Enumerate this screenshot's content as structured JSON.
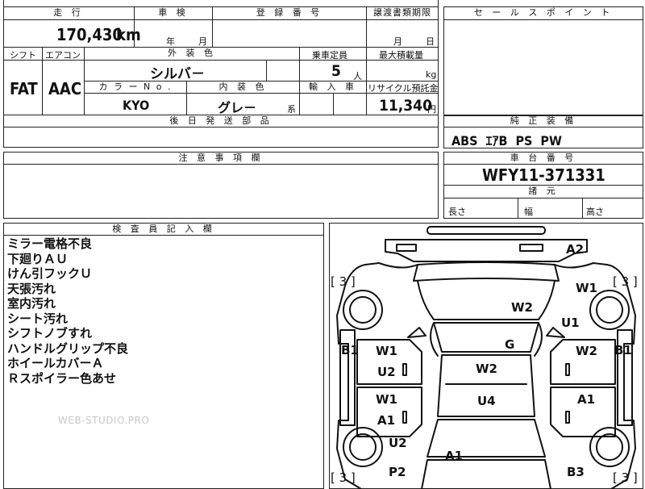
{
  "top": {
    "mileage_header": "走 行",
    "inspection_header": "車 検",
    "reg_header": "登 録 番 号",
    "transfer_header": "譲渡書類期限",
    "sales_header": "セ ー ル ス ポ イ ン ト",
    "mileage_value": "170,430",
    "mileage_unit": "km",
    "year_unit": "年",
    "month_unit": "月",
    "transfer_month": "月",
    "transfer_day": "日"
  },
  "specs": {
    "shift_header": "シフト",
    "ac_header": "エアコン",
    "ext_color_header": "外 装 色",
    "capacity_header": "乗車定員",
    "max_load_header": "最大積載量",
    "shift_value": "FAT",
    "ac_value": "AAC",
    "ext_color_value": "シルバ－",
    "capacity_value": "5",
    "capacity_unit": "人",
    "load_unit": "kg",
    "color_no_header": "カ ラ ー  N o .",
    "interior_header": "内 装 色",
    "import_header": "輸 入 車",
    "recycle_header": "リサイクル預託金",
    "color_no_value": "KYO",
    "interior_value": "グレ－",
    "interior_suffix": "系",
    "recycle_value": "11,340",
    "recycle_unit": "円",
    "later_parts_header": "後 日 発 送 部 品"
  },
  "equipment": {
    "header": "純 正 装 備",
    "value": "ABS  ｴｱB  PS  PW"
  },
  "notes_section": {
    "header": "注 意 事 項 欄"
  },
  "chassis": {
    "header": "車 台 番 号",
    "value": "WFY11-371331",
    "dims_header": "諸 元",
    "length_label": "長さ",
    "width_label": "幅",
    "height_label": "高さ"
  },
  "inspector": {
    "header": "検 査 員 記 入 欄",
    "lines": [
      "ミラー電格不良",
      "下廻りＡＵ",
      "けん引フックＵ",
      "天張汚れ",
      "室内汚れ",
      "シート汚れ",
      "シフトノブすれ",
      "ハンドルグリップ不良",
      "ホイールカバーＡ",
      "Ｒスポイラー色あせ"
    ]
  },
  "diagram": {
    "a2": "A2",
    "w1_right_front": "W1",
    "u1_right": "U1",
    "w2_hood": "W2",
    "g_windshield": "G",
    "b1_left": "B1",
    "b1_right": "B1",
    "w1_left_door": "W1",
    "u2_left_door": "U2",
    "w2_right_door": "W2",
    "w2_roof": "W2",
    "w1_left_rear": "W1",
    "a1_left_rear": "A1",
    "u4_roof": "U4",
    "a1_right_rear": "A1",
    "u2_left_bottom": "U2",
    "a1_bottom": "A1",
    "p2_bottom": "P2",
    "b3_bottom": "B3",
    "bracket_tl": "[ 3 ]",
    "bracket_tr": "[ 3 ]",
    "bracket_bl": "[ 3 ]",
    "bracket_br": "[ 3 ]"
  },
  "watermark": "WEB-STUDIO.PRO"
}
